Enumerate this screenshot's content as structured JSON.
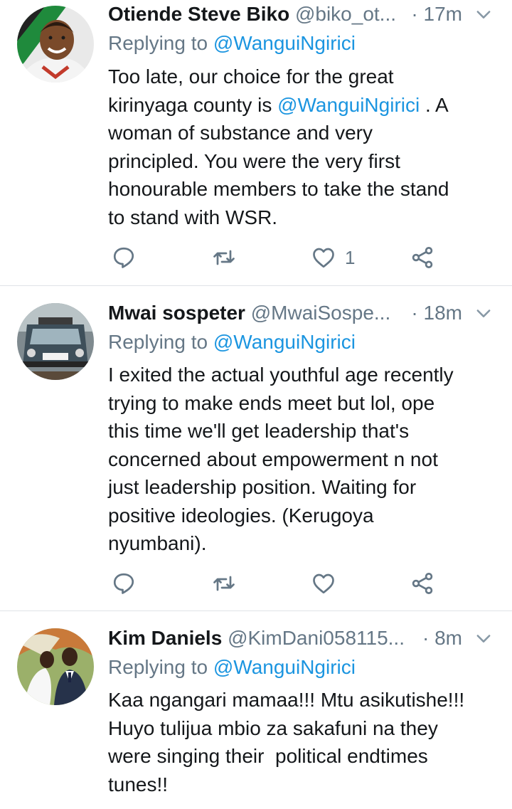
{
  "tweets": [
    {
      "name": "Otiende Steve Biko",
      "handle": "@biko_ot...",
      "time": "· 17m",
      "replying_prefix": "Replying to",
      "replying_to": "@WanguiNgirici",
      "lines": [
        {
          "pre": "Too late, our choice for the great",
          "mention": "",
          "post": ""
        },
        {
          "pre": "kirinyaga county is ",
          "mention": "@WanguiNgirici",
          "post": " . A"
        },
        {
          "pre": "woman of substance and very",
          "mention": "",
          "post": ""
        },
        {
          "pre": "principled. You were the very first",
          "mention": "",
          "post": ""
        },
        {
          "pre": "honourable members to take the stand",
          "mention": "",
          "post": ""
        },
        {
          "pre": "to stand with WSR.",
          "mention": "",
          "post": ""
        }
      ],
      "like_count": "1"
    },
    {
      "name": "Mwai sospeter",
      "handle": "@MwaiSospe...",
      "time": "· 18m",
      "replying_prefix": "Replying to",
      "replying_to": "@WanguiNgirici",
      "lines": [
        {
          "pre": "I exited the actual youthful age recently",
          "mention": "",
          "post": ""
        },
        {
          "pre": "trying to make ends meet but lol, ope",
          "mention": "",
          "post": ""
        },
        {
          "pre": "this time we'll get leadership that's",
          "mention": "",
          "post": ""
        },
        {
          "pre": "concerned about empowerment n not",
          "mention": "",
          "post": ""
        },
        {
          "pre": "just leadership position. Waiting for",
          "mention": "",
          "post": ""
        },
        {
          "pre": "positive ideologies. (Kerugoya",
          "mention": "",
          "post": ""
        },
        {
          "pre": "nyumbani).",
          "mention": "",
          "post": ""
        }
      ],
      "like_count": ""
    },
    {
      "name": "Kim Daniels",
      "handle": "@KimDani058115...",
      "time": "· 8m",
      "replying_prefix": "Replying to",
      "replying_to": "@WanguiNgirici",
      "lines": [
        {
          "pre": "Kaa ngangari mamaa!!! Mtu asikutishe!!!",
          "mention": "",
          "post": ""
        },
        {
          "pre": "Huyo tulijua mbio za sakafuni na they",
          "mention": "",
          "post": ""
        },
        {
          "pre": "were singing their  political endtimes",
          "mention": "",
          "post": ""
        },
        {
          "pre": "tunes!!",
          "mention": "",
          "post": ""
        }
      ],
      "like_count": ""
    }
  ],
  "icons": {
    "reply": "reply-icon",
    "retweet": "retweet-icon",
    "like": "heart-icon",
    "share": "share-icon",
    "menu": "chevron-down-icon"
  },
  "colors": {
    "text": "#14171a",
    "secondary": "#657786",
    "mention": "#1b95e0",
    "divider": "#dfe3e7"
  }
}
